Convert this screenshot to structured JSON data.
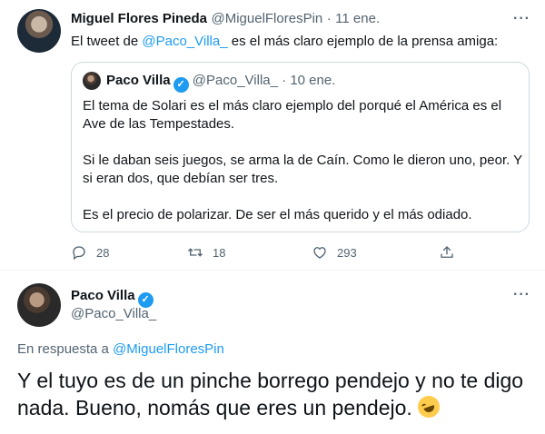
{
  "tweet1": {
    "author_name": "Miguel Flores Pineda",
    "author_handle": "@MiguelFloresPin",
    "separator": "·",
    "date": "11 ene.",
    "text_before": "El tweet de ",
    "text_mention": "@Paco_Villa_",
    "text_after": " es el más claro ejemplo de la prensa amiga:",
    "more": "···",
    "quote": {
      "author_name": "Paco Villa",
      "author_handle": "@Paco_Villa_",
      "separator": "·",
      "date": "10 ene.",
      "paragraphs": [
        "El tema de Solari es el más claro ejemplo del porqué el América es el Ave de las Tempestades.",
        "Si le daban seis juegos, se arma la de Caín. Como le dieron uno, peor. Y si eran dos, que debían ser tres.",
        "Es el precio de polarizar. De ser el más querido y el más odiado."
      ]
    },
    "actions": {
      "replies": "28",
      "retweets": "18",
      "likes": "293"
    }
  },
  "tweet2": {
    "author_name": "Paco Villa",
    "author_handle": "@Paco_Villa_",
    "more": "···",
    "reply_prefix": "En respuesta a ",
    "reply_to": "@MiguelFloresPin",
    "text": "Y el tuyo es de un pinche borrego pendejo y no te digo nada. Bueno, nomás que eres un pendejo.",
    "emoji": "rolling-on-floor-laughing"
  },
  "colors": {
    "accent": "#1d9bf0",
    "muted": "#536471",
    "text": "#0f1419",
    "border": "#cfd9de"
  }
}
